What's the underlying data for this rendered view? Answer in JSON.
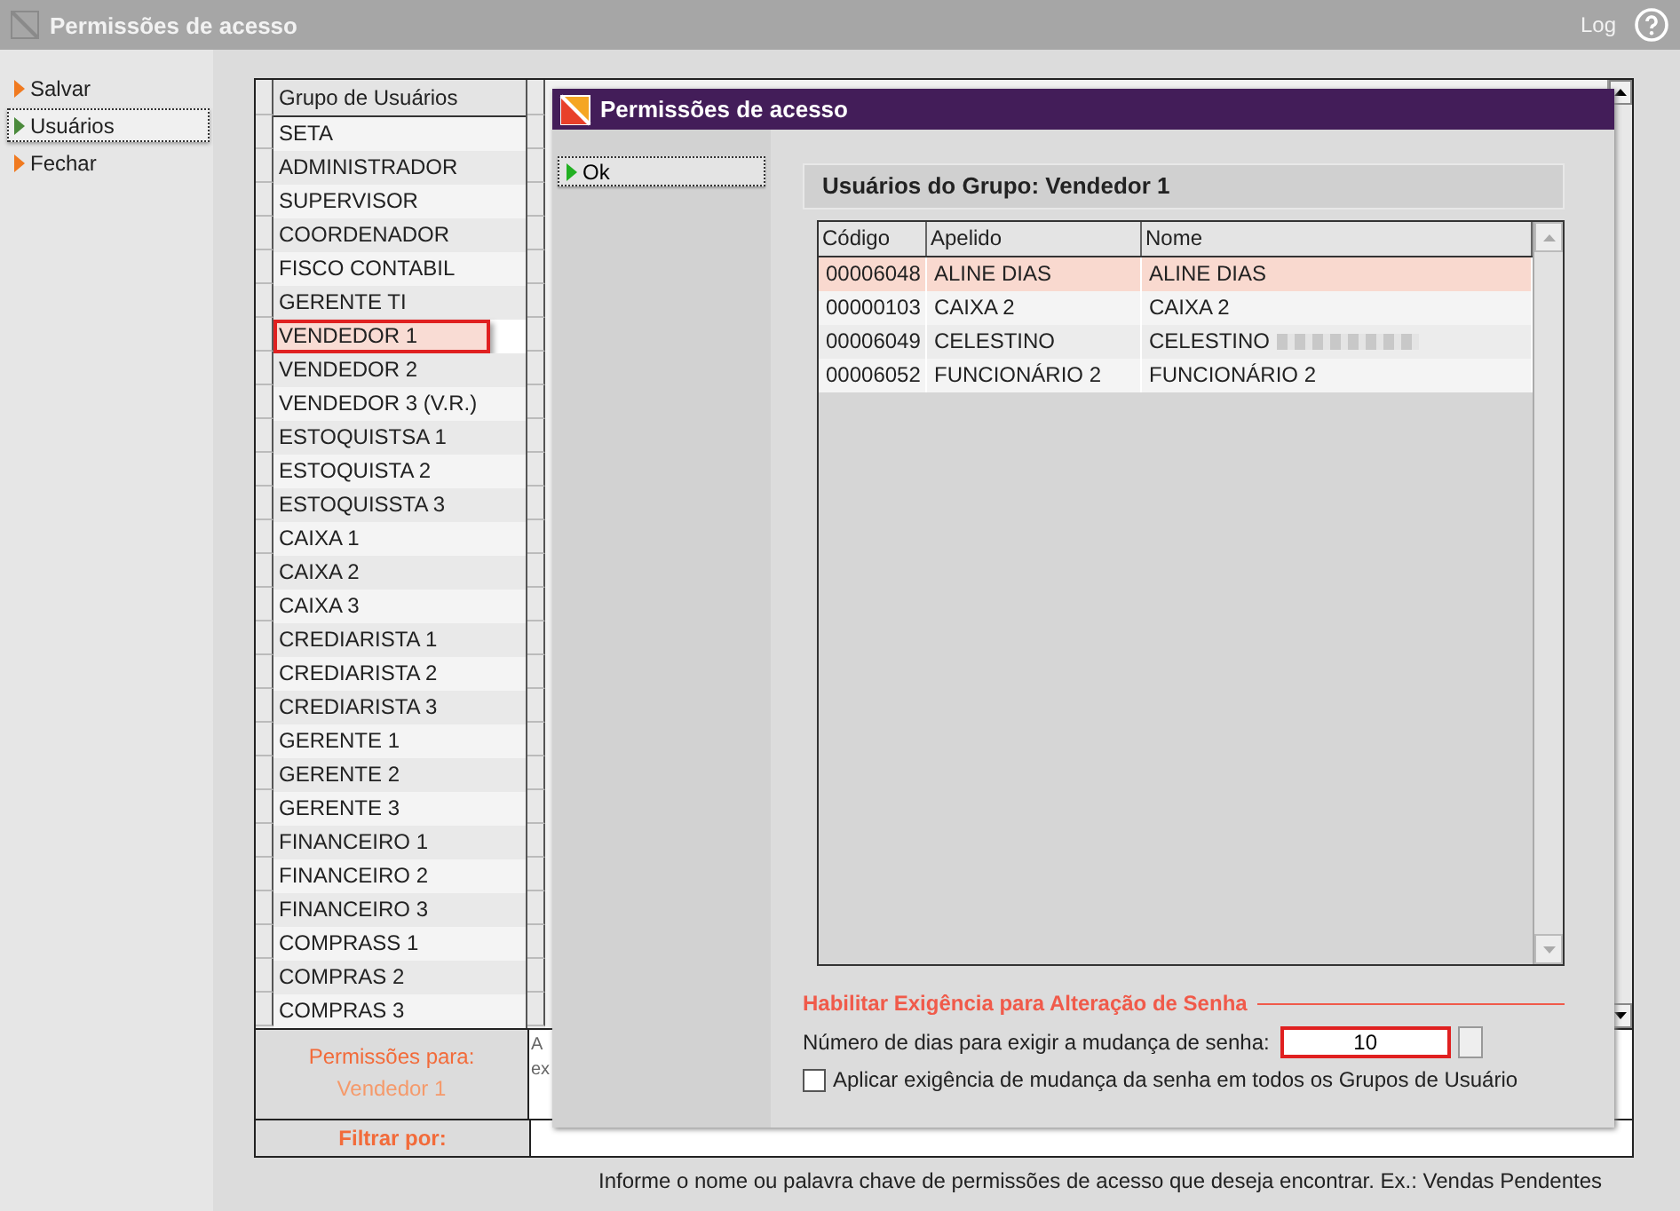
{
  "window": {
    "title": "Permissões de acesso",
    "log": "Log"
  },
  "sidebar": {
    "items": [
      {
        "label": "Salvar",
        "selected": false
      },
      {
        "label": "Usuários",
        "selected": true
      },
      {
        "label": "Fechar",
        "selected": false
      }
    ]
  },
  "groups": {
    "header": "Grupo de Usuários",
    "items": [
      {
        "label": "SETA",
        "selected": false,
        "highlighted": false
      },
      {
        "label": "ADMINISTRADOR",
        "selected": false,
        "highlighted": false
      },
      {
        "label": "SUPERVISOR",
        "selected": false,
        "highlighted": false
      },
      {
        "label": "COORDENADOR",
        "selected": false,
        "highlighted": false
      },
      {
        "label": "FISCO CONTABIL",
        "selected": false,
        "highlighted": false
      },
      {
        "label": "GERENTE TI",
        "selected": false,
        "highlighted": false
      },
      {
        "label": "VENDEDOR 1",
        "selected": true,
        "highlighted": true
      },
      {
        "label": "VENDEDOR 2",
        "selected": false,
        "highlighted": false
      },
      {
        "label": "VENDEDOR 3 (V.R.)",
        "selected": false,
        "highlighted": false
      },
      {
        "label": "ESTOQUISTSA 1",
        "selected": false,
        "highlighted": false
      },
      {
        "label": "ESTOQUISTA 2",
        "selected": false,
        "highlighted": false
      },
      {
        "label": "ESTOQUISSTA 3",
        "selected": false,
        "highlighted": false
      },
      {
        "label": "CAIXA 1",
        "selected": false,
        "highlighted": false
      },
      {
        "label": "CAIXA 2",
        "selected": false,
        "highlighted": false
      },
      {
        "label": "CAIXA 3",
        "selected": false,
        "highlighted": false
      },
      {
        "label": "CREDIARISTA 1",
        "selected": false,
        "highlighted": false
      },
      {
        "label": "CREDIARISTA 2",
        "selected": false,
        "highlighted": false
      },
      {
        "label": "CREDIARISTA 3",
        "selected": false,
        "highlighted": false
      },
      {
        "label": "GERENTE 1",
        "selected": false,
        "highlighted": false
      },
      {
        "label": "GERENTE 2",
        "selected": false,
        "highlighted": false
      },
      {
        "label": "GERENTE 3",
        "selected": false,
        "highlighted": false
      },
      {
        "label": "FINANCEIRO 1",
        "selected": false,
        "highlighted": false
      },
      {
        "label": "FINANCEIRO 2",
        "selected": false,
        "highlighted": false
      },
      {
        "label": "FINANCEIRO 3",
        "selected": false,
        "highlighted": false
      },
      {
        "label": "COMPRASS 1",
        "selected": false,
        "highlighted": false
      },
      {
        "label": "COMPRAS 2",
        "selected": false,
        "highlighted": false
      },
      {
        "label": "COMPRAS 3",
        "selected": false,
        "highlighted": false
      }
    ]
  },
  "permissions_for": {
    "label": "Permissões para:",
    "value": "Vendedor 1",
    "description_fragments": [
      "A",
      "ex"
    ]
  },
  "filter": {
    "label": "Filtrar por:",
    "hint": "Informe o nome ou palavra chave de permissões de acesso que deseja encontrar. Ex.: Vendas Pendentes"
  },
  "dialog": {
    "title": "Permissões de acesso",
    "ok_button": "Ok",
    "section_title": "Usuários do Grupo: Vendedor 1",
    "table": {
      "columns": [
        "Código",
        "Apelido",
        "Nome"
      ],
      "rows": [
        {
          "cells": [
            "00006048",
            "ALINE DIAS",
            "ALINE DIAS"
          ],
          "selected": true,
          "redacted": false
        },
        {
          "cells": [
            "00000103",
            "CAIXA 2",
            "CAIXA 2"
          ],
          "selected": false,
          "redacted": false
        },
        {
          "cells": [
            "00006049",
            "CELESTINO",
            "CELESTINO"
          ],
          "selected": false,
          "redacted": true
        },
        {
          "cells": [
            "00006052",
            "FUNCIONÁRIO 2",
            "FUNCIONÁRIO 2"
          ],
          "selected": false,
          "redacted": false
        }
      ]
    },
    "password": {
      "title": "Habilitar Exigência para Alteração de Senha",
      "days_label": "Número de dias para exigir a mudança de senha:",
      "days_value": "10",
      "days_highlighted": true,
      "apply_all": {
        "label": "Aplicar exigência de mudança da senha em todos os Grupos de Usuário",
        "checked": false
      }
    }
  }
}
